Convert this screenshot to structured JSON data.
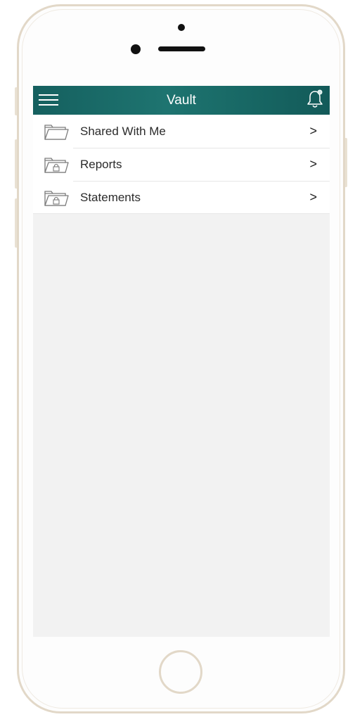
{
  "navbar": {
    "title": "Vault",
    "menu_icon": "hamburger-menu-icon",
    "notification_icon": "bell-icon"
  },
  "vault_items": [
    {
      "label": "Shared With Me",
      "icon": "folder-open-icon",
      "chevron": ">"
    },
    {
      "label": "Reports",
      "icon": "locked-folder-icon",
      "chevron": ">"
    },
    {
      "label": "Statements",
      "icon": "locked-folder-icon",
      "chevron": ">"
    }
  ],
  "colors": {
    "navbar_bg": "#1a6b68",
    "screen_bg": "#f2f2f2",
    "frame_gold": "#e2d8c8",
    "text": "#2b2b2b"
  }
}
